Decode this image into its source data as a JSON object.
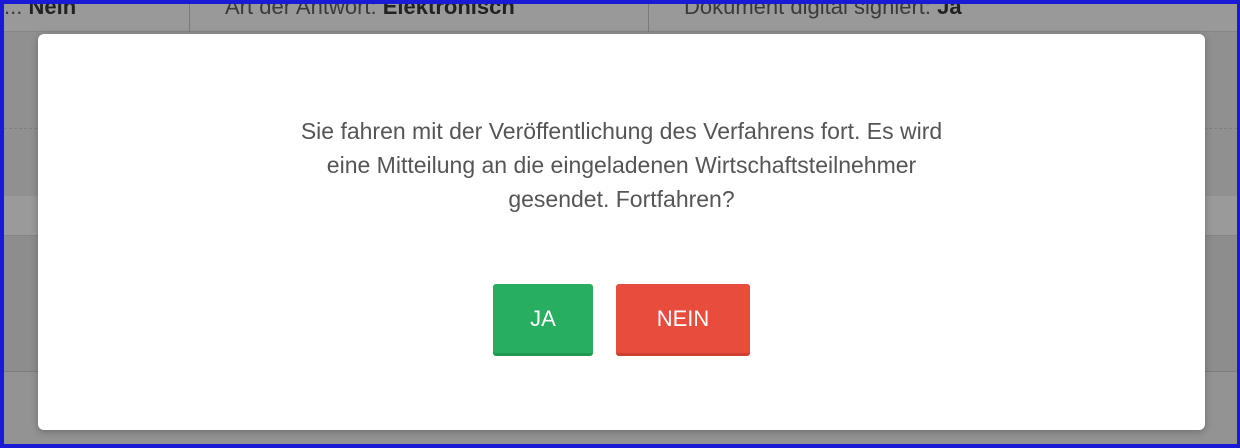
{
  "background": {
    "cells": [
      {
        "label": "...",
        "value": "Nein"
      },
      {
        "label": "Art der Antwort:",
        "value": "Elektronisch"
      },
      {
        "label": "Dokument digital signiert:",
        "value": "Ja"
      }
    ]
  },
  "modal": {
    "message_lines": [
      "Sie fahren mit der Veröffentlichung des Verfahrens fort. Es wird",
      "eine Mitteilung an die eingeladenen Wirtschaftsteilnehmer",
      "gesendet. Fortfahren?"
    ],
    "yes_label": "JA",
    "no_label": "NEIN"
  },
  "colors": {
    "yes_button": "#27ae60",
    "no_button": "#e74c3c",
    "frame": "#1a1ad6"
  }
}
